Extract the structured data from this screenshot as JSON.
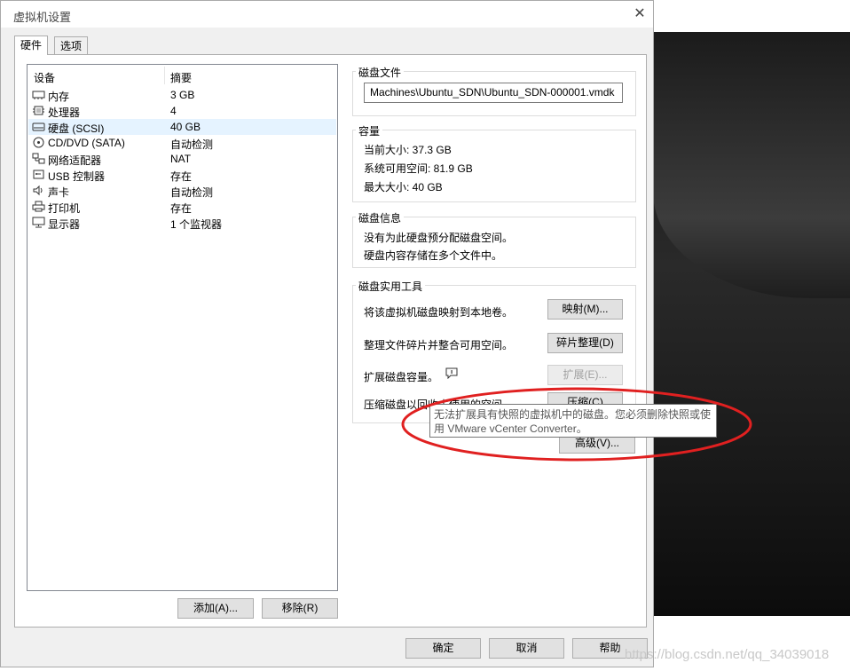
{
  "dialog": {
    "title": "虚拟机设置"
  },
  "tabs": [
    {
      "label": "硬件"
    },
    {
      "label": "选项"
    }
  ],
  "device_list": {
    "headers": [
      "设备",
      "摘要"
    ],
    "rows": [
      {
        "name": "内存",
        "summary": "3 GB",
        "icon": "memory-icon"
      },
      {
        "name": "处理器",
        "summary": "4",
        "icon": "cpu-icon"
      },
      {
        "name": "硬盘 (SCSI)",
        "summary": "40 GB",
        "icon": "hard-disk-icon"
      },
      {
        "name": "CD/DVD (SATA)",
        "summary": "自动检测",
        "icon": "cd-dvd-icon"
      },
      {
        "name": "网络适配器",
        "summary": "NAT",
        "icon": "network-adapter-icon"
      },
      {
        "name": "USB 控制器",
        "summary": "存在",
        "icon": "usb-icon"
      },
      {
        "name": "声卡",
        "summary": "自动检测",
        "icon": "speaker-icon"
      },
      {
        "name": "打印机",
        "summary": "存在",
        "icon": "printer-icon"
      },
      {
        "name": "显示器",
        "summary": "1 个监视器",
        "icon": "monitor-icon"
      }
    ],
    "selected_index": 2,
    "add_button": "添加(A)...",
    "remove_button": "移除(R)"
  },
  "disk_file": {
    "title": "磁盘文件",
    "value": "Machines\\Ubuntu_SDN\\Ubuntu_SDN-000001.vmdk"
  },
  "capacity": {
    "title": "容量",
    "current_size": "当前大小: 37.3 GB",
    "system_free": "系统可用空间: 81.9 GB",
    "max_size": "最大大小: 40 GB"
  },
  "disk_info": {
    "title": "磁盘信息",
    "line1": "没有为此硬盘预分配磁盘空间。",
    "line2": "硬盘内容存储在多个文件中。"
  },
  "disk_utilities": {
    "title": "磁盘实用工具",
    "map_label": "将该虚拟机磁盘映射到本地卷。",
    "map_button": "映射(M)...",
    "defrag_label": "整理文件碎片并整合可用空间。",
    "defrag_button": "碎片整理(D)",
    "expand_label": "扩展磁盘容量。",
    "expand_button": "扩展(E)...",
    "compact_label": "压缩磁盘以回收未使用的空间。",
    "compact_button": "压缩(C)",
    "advanced_button": "高级(V)..."
  },
  "tooltip": {
    "line1": "无法扩展具有快照的虚拟机中的磁盘。您必须删除快照或使",
    "line2": "用 VMware vCenter Converter。"
  },
  "footer": {
    "ok_button": "确定",
    "cancel_button": "取消",
    "help_button": "帮助"
  },
  "watermark": "https://blog.csdn.net/qq_34039018",
  "colors": {
    "selection": "#e5f3ff",
    "annotation": "#e02020",
    "dialog_bg": "#f0f0f0"
  }
}
